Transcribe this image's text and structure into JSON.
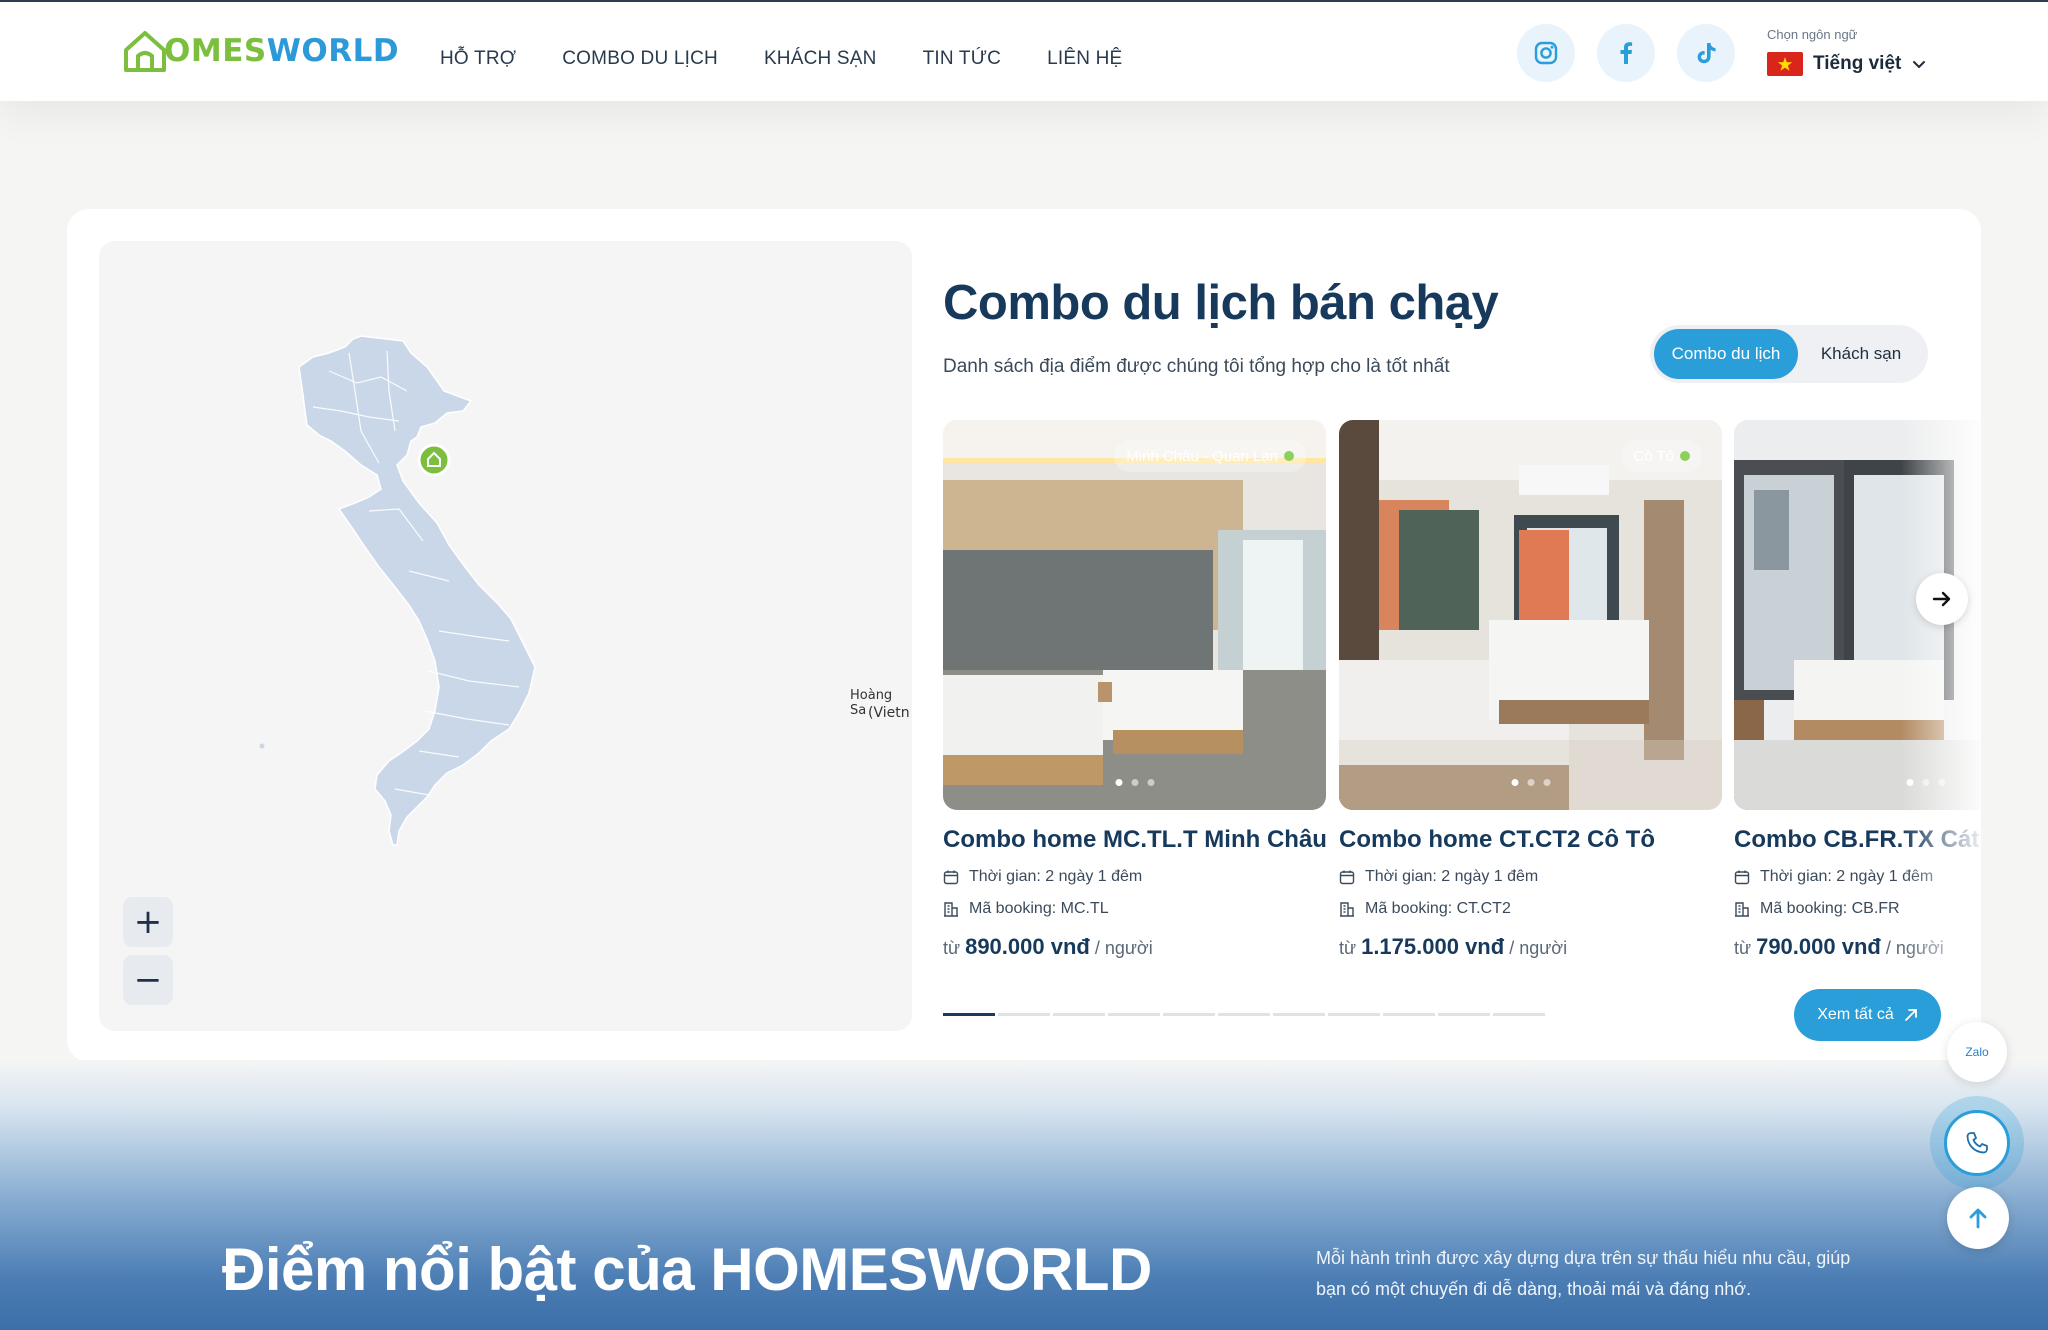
{
  "header": {
    "logo": {
      "part1": "H",
      "part2": "OMES",
      "part3": "WORLD"
    },
    "nav": [
      "HỖ TRỢ",
      "COMBO DU LỊCH",
      "KHÁCH SẠN",
      "TIN TỨC",
      "LIÊN HỆ"
    ],
    "social_icons": [
      "instagram-icon",
      "facebook-icon",
      "tiktok-icon"
    ],
    "language": {
      "caption": "Chọn ngôn ngữ",
      "selected": "Tiếng việt",
      "flag": "vietnam-flag"
    }
  },
  "map": {
    "labels": {
      "paracel": "Hoàng Sa",
      "paracel_sub": "(Vietn"
    },
    "zoom_in": "+",
    "zoom_out": "−"
  },
  "section": {
    "title": "Combo du lịch bán chạy",
    "subtitle": "Danh sách địa điểm được chúng tôi tổng hợp cho là tốt nhất",
    "tabs": {
      "active": "Combo du lịch",
      "inactive": "Khách sạn"
    }
  },
  "tours": [
    {
      "location": "Minh Châu - Quan Lạn",
      "name": "Combo home MC.TL.T Minh Châu",
      "duration": "Thời gian: 2 ngày 1 đêm",
      "booking": "Mã booking: MC.TL",
      "price_prefix": "từ",
      "price": "890.000 vnđ",
      "price_suffix": "/ người"
    },
    {
      "location": "Cô Tô",
      "name": "Combo home CT.CT2 Cô Tô",
      "duration": "Thời gian: 2 ngày 1 đêm",
      "booking": "Mã booking: CT.CT2",
      "price_prefix": "từ",
      "price": "1.175.000 vnđ",
      "price_suffix": "/ người"
    },
    {
      "location": "",
      "name": "Combo CB.FR.TX Cát B",
      "duration": "Thời gian: 2 ngày 1 đêm",
      "booking": "Mã booking: CB.FR",
      "price_prefix": "từ",
      "price": "790.000 vnđ",
      "price_suffix": "/ người"
    }
  ],
  "carousel": {
    "pages": 11,
    "current": 1
  },
  "view_all": "Xem tất cả",
  "hero": {
    "title": "Điểm nổi bật của HOMESWORLD",
    "text": "Mỗi hành trình được xây dựng dựa trên sự thấu hiểu nhu cầu, giúp bạn có một chuyến đi dễ dàng, thoải mái và đáng nhớ."
  },
  "floating": {
    "zalo": "Zalo"
  },
  "colors": {
    "primary": "#2a9ed8",
    "navy": "#173a5c",
    "green": "#7cbf3e"
  }
}
